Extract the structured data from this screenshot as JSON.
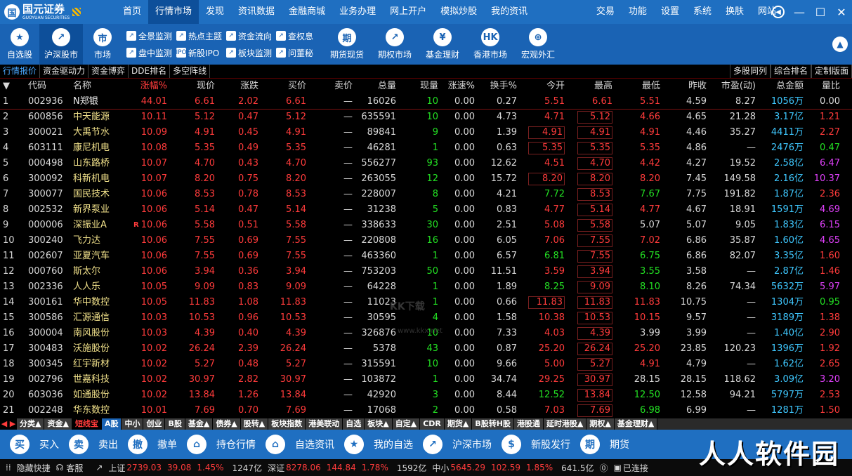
{
  "app": {
    "logo_text": "国元证券",
    "logo_sub": "GUOYUAN SECURITIES"
  },
  "nav": [
    "首页",
    "行情市场",
    "发现",
    "资讯数据",
    "金融商城",
    "业务办理",
    "网上开户",
    "模拟炒股",
    "我的资讯"
  ],
  "nav_active": 1,
  "right_nav": [
    "交易",
    "功能",
    "设置",
    "系统",
    "换肤",
    "网站"
  ],
  "toolbar": {
    "big_left": [
      {
        "icon": "star-icon",
        "glyph": "★",
        "label": "自选股"
      },
      {
        "icon": "chart-up-icon",
        "glyph": "↗",
        "label": "沪深股市"
      },
      {
        "icon": "market-icon",
        "glyph": "市",
        "label": "市场"
      }
    ],
    "small_col1": [
      {
        "icon": "monitor-icon",
        "label": "全景监测"
      },
      {
        "icon": "monitor2-icon",
        "label": "盘中监测"
      }
    ],
    "small_col2": [
      {
        "icon": "hot-topic-icon",
        "label": "热点主题"
      },
      {
        "icon": "ipo-icon",
        "glyph": "IPO",
        "label": "新股IPO"
      }
    ],
    "small_col3": [
      {
        "icon": "fund-flow-icon",
        "label": "资金流向"
      },
      {
        "icon": "sector-icon",
        "label": "板块监测"
      }
    ],
    "small_col4": [
      {
        "icon": "query-icon",
        "label": "查权息"
      },
      {
        "icon": "ask-icon",
        "label": "问董秘"
      }
    ],
    "big_right": [
      {
        "icon": "futures-icon",
        "glyph": "期",
        "label": "期货现货"
      },
      {
        "icon": "options-icon",
        "glyph": "↗",
        "label": "期权市场"
      },
      {
        "icon": "fund-icon",
        "glyph": "¥",
        "label": "基金理财"
      },
      {
        "icon": "hk-icon",
        "glyph": "HK",
        "label": "香港市场"
      },
      {
        "icon": "globe-icon",
        "glyph": "⊕",
        "label": "宏观外汇"
      }
    ]
  },
  "subtabs": [
    "行情报价",
    "资金驱动力",
    "资金博弈",
    "DDE排名",
    "多空阵线"
  ],
  "subtabs_right": [
    "多股同列",
    "综合排名",
    "定制版面"
  ],
  "columns": [
    "代码",
    "名称",
    "涨幅%",
    "现价",
    "涨跌",
    "买价",
    "卖价",
    "总量",
    "现量",
    "涨速%",
    "换手%",
    "今开",
    "最高",
    "最低",
    "昨收",
    "市盈(动)",
    "总金额",
    "量比"
  ],
  "rows": [
    {
      "no": "1",
      "code": "002936",
      "name": "N郑银",
      "pct": "44.01",
      "price": "6.61",
      "chg": "2.02",
      "bid": "6.61",
      "ask": "—",
      "vol": "16026",
      "cur": "10",
      "spd": "0.00",
      "turn": "0.27",
      "open": "5.51",
      "high": "6.61",
      "low": "5.51",
      "prev": "4.59",
      "pe": "8.27",
      "amt": "1056万",
      "ratio": "0.00",
      "cur_c": "green",
      "open_c": "red",
      "high_c": "red",
      "low_c": "red",
      "ratio_c": "white",
      "box_open": false,
      "box_high": false
    },
    {
      "no": "2",
      "code": "600856",
      "name": "中天能源",
      "pct": "10.11",
      "price": "5.12",
      "chg": "0.47",
      "bid": "5.12",
      "ask": "—",
      "vol": "635591",
      "cur": "10",
      "spd": "0.00",
      "turn": "4.73",
      "open": "4.71",
      "high": "5.12",
      "low": "4.66",
      "prev": "4.65",
      "pe": "21.28",
      "amt": "3.17亿",
      "ratio": "1.21",
      "cur_c": "green",
      "open_c": "red",
      "high_c": "red",
      "low_c": "red",
      "ratio_c": "red",
      "box_open": false,
      "box_high": true
    },
    {
      "no": "3",
      "code": "300021",
      "name": "大禹节水",
      "pct": "10.09",
      "price": "4.91",
      "chg": "0.45",
      "bid": "4.91",
      "ask": "—",
      "vol": "89841",
      "cur": "9",
      "spd": "0.00",
      "turn": "1.39",
      "open": "4.91",
      "high": "4.91",
      "low": "4.91",
      "prev": "4.46",
      "pe": "35.27",
      "amt": "4411万",
      "ratio": "2.27",
      "cur_c": "green",
      "open_c": "red",
      "high_c": "red",
      "low_c": "red",
      "ratio_c": "red",
      "box_open": true,
      "box_high": true
    },
    {
      "no": "4",
      "code": "603111",
      "name": "康尼机电",
      "pct": "10.08",
      "price": "5.35",
      "chg": "0.49",
      "bid": "5.35",
      "ask": "—",
      "vol": "46281",
      "cur": "1",
      "spd": "0.00",
      "turn": "0.63",
      "open": "5.35",
      "high": "5.35",
      "low": "5.35",
      "prev": "4.86",
      "pe": "—",
      "amt": "2476万",
      "ratio": "0.47",
      "cur_c": "green",
      "open_c": "red",
      "high_c": "red",
      "low_c": "red",
      "ratio_c": "green",
      "box_open": true,
      "box_high": true
    },
    {
      "no": "5",
      "code": "000498",
      "name": "山东路桥",
      "pct": "10.07",
      "price": "4.70",
      "chg": "0.43",
      "bid": "4.70",
      "ask": "—",
      "vol": "556277",
      "cur": "93",
      "spd": "0.00",
      "turn": "12.62",
      "open": "4.51",
      "high": "4.70",
      "low": "4.42",
      "prev": "4.27",
      "pe": "19.52",
      "amt": "2.58亿",
      "ratio": "6.47",
      "cur_c": "green",
      "open_c": "red",
      "high_c": "red",
      "low_c": "red",
      "ratio_c": "mag",
      "box_open": false,
      "box_high": true
    },
    {
      "no": "6",
      "code": "300092",
      "name": "科新机电",
      "pct": "10.07",
      "price": "8.20",
      "chg": "0.75",
      "bid": "8.20",
      "ask": "—",
      "vol": "263055",
      "cur": "12",
      "spd": "0.00",
      "turn": "15.72",
      "open": "8.20",
      "high": "8.20",
      "low": "8.20",
      "prev": "7.45",
      "pe": "149.58",
      "amt": "2.16亿",
      "ratio": "10.37",
      "cur_c": "green",
      "open_c": "red",
      "high_c": "red",
      "low_c": "red",
      "ratio_c": "mag",
      "box_open": true,
      "box_high": true
    },
    {
      "no": "7",
      "code": "300077",
      "name": "国民技术",
      "pct": "10.06",
      "price": "8.53",
      "chg": "0.78",
      "bid": "8.53",
      "ask": "—",
      "vol": "228007",
      "cur": "8",
      "spd": "0.00",
      "turn": "4.21",
      "open": "7.72",
      "high": "8.53",
      "low": "7.67",
      "prev": "7.75",
      "pe": "191.82",
      "amt": "1.87亿",
      "ratio": "2.36",
      "cur_c": "green",
      "open_c": "green",
      "high_c": "red",
      "low_c": "green",
      "ratio_c": "red",
      "box_open": false,
      "box_high": true
    },
    {
      "no": "8",
      "code": "002532",
      "name": "新界泵业",
      "pct": "10.06",
      "price": "5.14",
      "chg": "0.47",
      "bid": "5.14",
      "ask": "—",
      "vol": "31238",
      "cur": "5",
      "spd": "0.00",
      "turn": "0.83",
      "open": "4.77",
      "high": "5.14",
      "low": "4.77",
      "prev": "4.67",
      "pe": "18.91",
      "amt": "1591万",
      "ratio": "4.69",
      "cur_c": "green",
      "open_c": "red",
      "high_c": "red",
      "low_c": "red",
      "ratio_c": "mag",
      "box_open": false,
      "box_high": true
    },
    {
      "no": "9",
      "code": "000006",
      "name": "深振业A",
      "pct": "10.06",
      "price": "5.58",
      "chg": "0.51",
      "bid": "5.58",
      "ask": "—",
      "vol": "338633",
      "cur": "30",
      "spd": "0.00",
      "turn": "2.51",
      "open": "5.08",
      "high": "5.58",
      "low": "5.07",
      "prev": "5.07",
      "pe": "9.05",
      "amt": "1.83亿",
      "ratio": "6.15",
      "cur_c": "green",
      "open_c": "red",
      "high_c": "red",
      "low_c": "white",
      "ratio_c": "mag",
      "box_open": false,
      "box_high": true,
      "rmark": true
    },
    {
      "no": "10",
      "code": "300240",
      "name": "飞力达",
      "pct": "10.06",
      "price": "7.55",
      "chg": "0.69",
      "bid": "7.55",
      "ask": "—",
      "vol": "220808",
      "cur": "16",
      "spd": "0.00",
      "turn": "6.05",
      "open": "7.06",
      "high": "7.55",
      "low": "7.02",
      "prev": "6.86",
      "pe": "35.87",
      "amt": "1.60亿",
      "ratio": "4.65",
      "cur_c": "green",
      "open_c": "red",
      "high_c": "red",
      "low_c": "red",
      "ratio_c": "mag",
      "box_open": false,
      "box_high": true
    },
    {
      "no": "11",
      "code": "002607",
      "name": "亚夏汽车",
      "pct": "10.06",
      "price": "7.55",
      "chg": "0.69",
      "bid": "7.55",
      "ask": "—",
      "vol": "463360",
      "cur": "1",
      "spd": "0.00",
      "turn": "6.57",
      "open": "6.81",
      "high": "7.55",
      "low": "6.75",
      "prev": "6.86",
      "pe": "82.07",
      "amt": "3.35亿",
      "ratio": "1.60",
      "cur_c": "green",
      "open_c": "green",
      "high_c": "red",
      "low_c": "green",
      "ratio_c": "red",
      "box_open": false,
      "box_high": true
    },
    {
      "no": "12",
      "code": "000760",
      "name": "斯太尔",
      "pct": "10.06",
      "price": "3.94",
      "chg": "0.36",
      "bid": "3.94",
      "ask": "—",
      "vol": "753203",
      "cur": "50",
      "spd": "0.00",
      "turn": "11.51",
      "open": "3.59",
      "high": "3.94",
      "low": "3.55",
      "prev": "3.58",
      "pe": "—",
      "amt": "2.87亿",
      "ratio": "1.46",
      "cur_c": "green",
      "open_c": "red",
      "high_c": "red",
      "low_c": "green",
      "ratio_c": "red",
      "box_open": false,
      "box_high": true
    },
    {
      "no": "13",
      "code": "002336",
      "name": "人人乐",
      "pct": "10.05",
      "price": "9.09",
      "chg": "0.83",
      "bid": "9.09",
      "ask": "—",
      "vol": "64228",
      "cur": "1",
      "spd": "0.00",
      "turn": "1.89",
      "open": "8.25",
      "high": "9.09",
      "low": "8.10",
      "prev": "8.26",
      "pe": "74.34",
      "amt": "5632万",
      "ratio": "5.97",
      "cur_c": "green",
      "open_c": "green",
      "high_c": "red",
      "low_c": "green",
      "ratio_c": "mag",
      "box_open": false,
      "box_high": true
    },
    {
      "no": "14",
      "code": "300161",
      "name": "华中数控",
      "pct": "10.05",
      "price": "11.83",
      "chg": "1.08",
      "bid": "11.83",
      "ask": "—",
      "vol": "11023",
      "cur": "1",
      "spd": "0.00",
      "turn": "0.66",
      "open": "11.83",
      "high": "11.83",
      "low": "11.83",
      "prev": "10.75",
      "pe": "—",
      "amt": "1304万",
      "ratio": "0.95",
      "cur_c": "green",
      "open_c": "red",
      "high_c": "red",
      "low_c": "red",
      "ratio_c": "green",
      "box_open": true,
      "box_high": true
    },
    {
      "no": "15",
      "code": "300586",
      "name": "汇源通信",
      "pct": "10.03",
      "price": "10.53",
      "chg": "0.96",
      "bid": "10.53",
      "ask": "—",
      "vol": "30595",
      "cur": "4",
      "spd": "0.00",
      "turn": "1.58",
      "open": "10.38",
      "high": "10.53",
      "low": "10.15",
      "prev": "9.57",
      "pe": "—",
      "amt": "3189万",
      "ratio": "1.38",
      "cur_c": "green",
      "open_c": "red",
      "high_c": "red",
      "low_c": "red",
      "ratio_c": "red",
      "box_open": false,
      "box_high": true
    },
    {
      "no": "16",
      "code": "300004",
      "name": "南风股份",
      "pct": "10.03",
      "price": "4.39",
      "chg": "0.40",
      "bid": "4.39",
      "ask": "—",
      "vol": "326876",
      "cur": "10",
      "spd": "0.00",
      "turn": "7.33",
      "open": "4.03",
      "high": "4.39",
      "low": "3.99",
      "prev": "3.99",
      "pe": "—",
      "amt": "1.40亿",
      "ratio": "2.90",
      "cur_c": "green",
      "open_c": "red",
      "high_c": "red",
      "low_c": "white",
      "ratio_c": "red",
      "box_open": false,
      "box_high": true
    },
    {
      "no": "17",
      "code": "300483",
      "name": "沃施股份",
      "pct": "10.02",
      "price": "26.24",
      "chg": "2.39",
      "bid": "26.24",
      "ask": "—",
      "vol": "5378",
      "cur": "43",
      "spd": "0.00",
      "turn": "0.87",
      "open": "25.20",
      "high": "26.24",
      "low": "25.20",
      "prev": "23.85",
      "pe": "120.23",
      "amt": "1396万",
      "ratio": "1.92",
      "cur_c": "green",
      "open_c": "red",
      "high_c": "red",
      "low_c": "red",
      "ratio_c": "red",
      "box_open": false,
      "box_high": true
    },
    {
      "no": "18",
      "code": "300345",
      "name": "红宇新材",
      "pct": "10.02",
      "price": "5.27",
      "chg": "0.48",
      "bid": "5.27",
      "ask": "—",
      "vol": "315591",
      "cur": "10",
      "spd": "0.00",
      "turn": "9.66",
      "open": "5.00",
      "high": "5.27",
      "low": "4.91",
      "prev": "4.79",
      "pe": "—",
      "amt": "1.62亿",
      "ratio": "2.65",
      "cur_c": "green",
      "open_c": "red",
      "high_c": "red",
      "low_c": "red",
      "ratio_c": "red",
      "box_open": false,
      "box_high": true
    },
    {
      "no": "19",
      "code": "002796",
      "name": "世嘉科技",
      "pct": "10.02",
      "price": "30.97",
      "chg": "2.82",
      "bid": "30.97",
      "ask": "—",
      "vol": "103872",
      "cur": "1",
      "spd": "0.00",
      "turn": "34.74",
      "open": "29.25",
      "high": "30.97",
      "low": "28.15",
      "prev": "28.15",
      "pe": "118.62",
      "amt": "3.09亿",
      "ratio": "3.20",
      "cur_c": "green",
      "open_c": "red",
      "high_c": "red",
      "low_c": "white",
      "ratio_c": "mag",
      "box_open": false,
      "box_high": true
    },
    {
      "no": "20",
      "code": "603036",
      "name": "如通股份",
      "pct": "10.02",
      "price": "13.84",
      "chg": "1.26",
      "bid": "13.84",
      "ask": "—",
      "vol": "42920",
      "cur": "3",
      "spd": "0.00",
      "turn": "8.44",
      "open": "12.52",
      "high": "13.84",
      "low": "12.50",
      "prev": "12.58",
      "pe": "94.21",
      "amt": "5797万",
      "ratio": "2.53",
      "cur_c": "green",
      "open_c": "green",
      "high_c": "red",
      "low_c": "green",
      "ratio_c": "red",
      "box_open": false,
      "box_high": true
    },
    {
      "no": "21",
      "code": "002248",
      "name": "华东数控",
      "pct": "10.01",
      "price": "7.69",
      "chg": "0.70",
      "bid": "7.69",
      "ask": "—",
      "vol": "17068",
      "cur": "2",
      "spd": "0.00",
      "turn": "0.58",
      "open": "7.03",
      "high": "7.69",
      "low": "6.98",
      "prev": "6.99",
      "pe": "—",
      "amt": "1281万",
      "ratio": "1.50",
      "cur_c": "green",
      "open_c": "red",
      "high_c": "red",
      "low_c": "green",
      "ratio_c": "red",
      "box_open": false,
      "box_high": true
    }
  ],
  "watermark": {
    "text": "KK下载",
    "sub": "www.kkx.net"
  },
  "bottom_tabs": [
    "分类▲",
    "资金▲",
    "短线宝",
    "A股",
    "中小",
    "创业",
    "B股",
    "基金▲",
    "债券▲",
    "股转▲",
    "板块指数",
    "港美联动",
    "自选",
    "板块▲",
    "自定▲",
    "CDR",
    "期货▲",
    "B股转H股",
    "港股通",
    "延时港股▲",
    "期权▲",
    "基金理财▲"
  ],
  "bottom_tab_active": 3,
  "bottom_tab_highlight": 2,
  "actions": [
    {
      "icon": "buy-icon",
      "glyph": "买",
      "label": "买入"
    },
    {
      "icon": "sell-icon",
      "glyph": "卖",
      "label": "卖出"
    },
    {
      "icon": "cancel-order-icon",
      "glyph": "撤",
      "label": "撤单"
    },
    {
      "icon": "holdings-icon",
      "glyph": "⌂",
      "label": "持仓行情"
    },
    {
      "icon": "news-icon",
      "glyph": "⌂",
      "label": "自选资讯"
    },
    {
      "icon": "my-fav-icon",
      "glyph": "★",
      "label": "我的自选"
    },
    {
      "icon": "hs-market-icon",
      "glyph": "↗",
      "label": "沪深市场"
    },
    {
      "icon": "ipo-issue-icon",
      "glyph": "$",
      "label": "新股发行"
    },
    {
      "icon": "futures2-icon",
      "glyph": "期",
      "label": "期货"
    }
  ],
  "status": {
    "hide_shortcut": "隐藏快捷",
    "service": "客服",
    "sh_label": "上证",
    "sh_idx": "2739.03",
    "sh_chg": "39.08",
    "sh_pct": "1.45%",
    "sh_amt": "1247亿",
    "sz_label": "深证",
    "sz_idx": "8278.06",
    "sz_chg": "144.84",
    "sz_pct": "1.78%",
    "sz_amt": "1592亿",
    "zx_label": "中小",
    "zx_idx": "5645.29",
    "zx_chg": "102.59",
    "zx_pct": "1.85%",
    "zx_amt": "641.5亿",
    "conn": "已连接"
  },
  "overlay_watermark": "人人软件园"
}
